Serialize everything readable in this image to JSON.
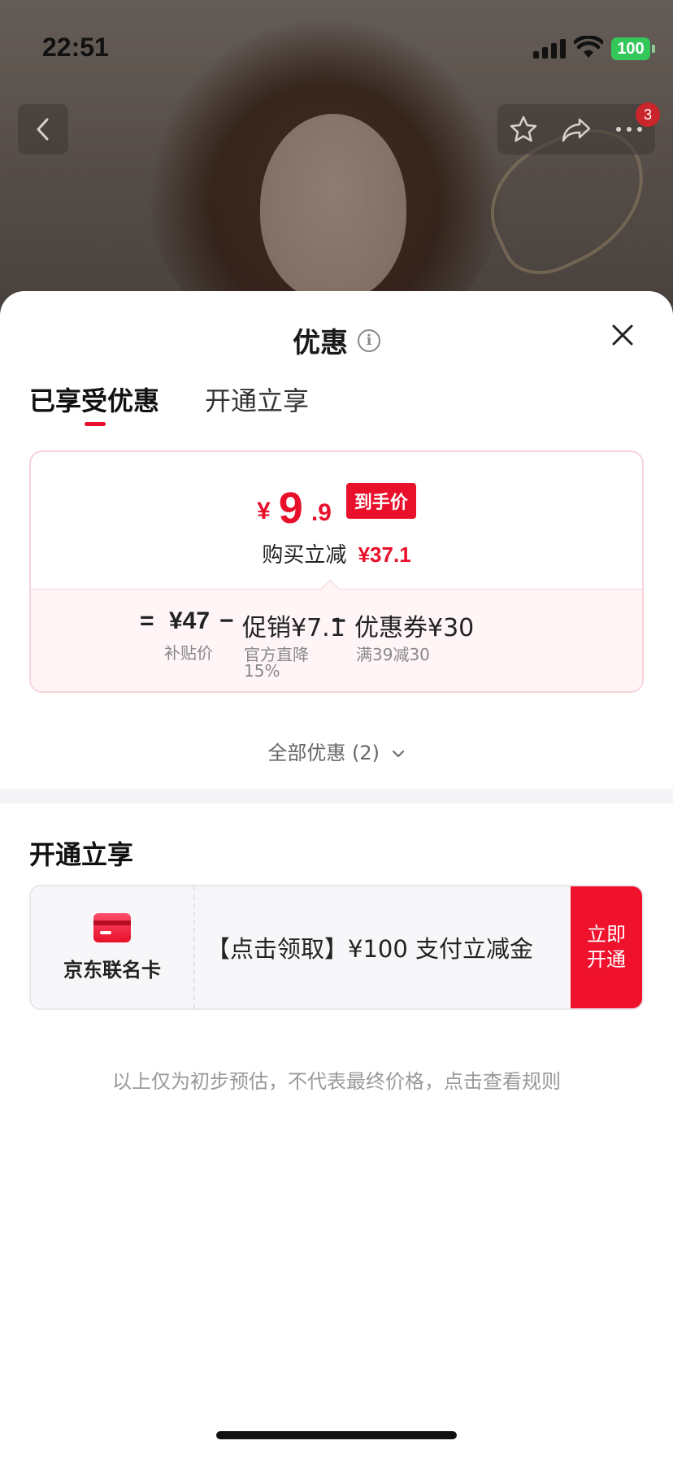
{
  "status_bar": {
    "time": "22:51",
    "battery": "100"
  },
  "top_nav": {
    "badge_count": "3"
  },
  "sheet": {
    "title": "优惠",
    "tabs": [
      {
        "label": "已享受优惠"
      },
      {
        "label": "开通立享"
      }
    ],
    "price_card": {
      "currency": "¥",
      "price_int": "9",
      "price_dec": ".9",
      "price_tag": "到手价",
      "reduce_label": "购买立减",
      "reduce_amount": "¥37.1",
      "formula": {
        "equals": "=",
        "base_price": "¥47",
        "minus1": "−",
        "promo": "促销¥7.1",
        "minus2": "−",
        "coupon": "优惠券¥30"
      },
      "labels": {
        "base_label": "补贴价",
        "promo_label": "官方直降",
        "promo_pct": "15%",
        "coupon_label": "满39减30"
      }
    },
    "all_offers": "全部优惠 (2)",
    "section_title": "开通立享",
    "card_offer": {
      "card_name": "京东联名卡",
      "offer_text": "【点击领取】¥100 支付立减金",
      "button_label": "立即开通"
    },
    "disclaimer": "以上仅为初步预估，不代表最终价格，点击查看规则"
  },
  "colors": {
    "accent": "#e8102a",
    "battery": "#34c759"
  }
}
